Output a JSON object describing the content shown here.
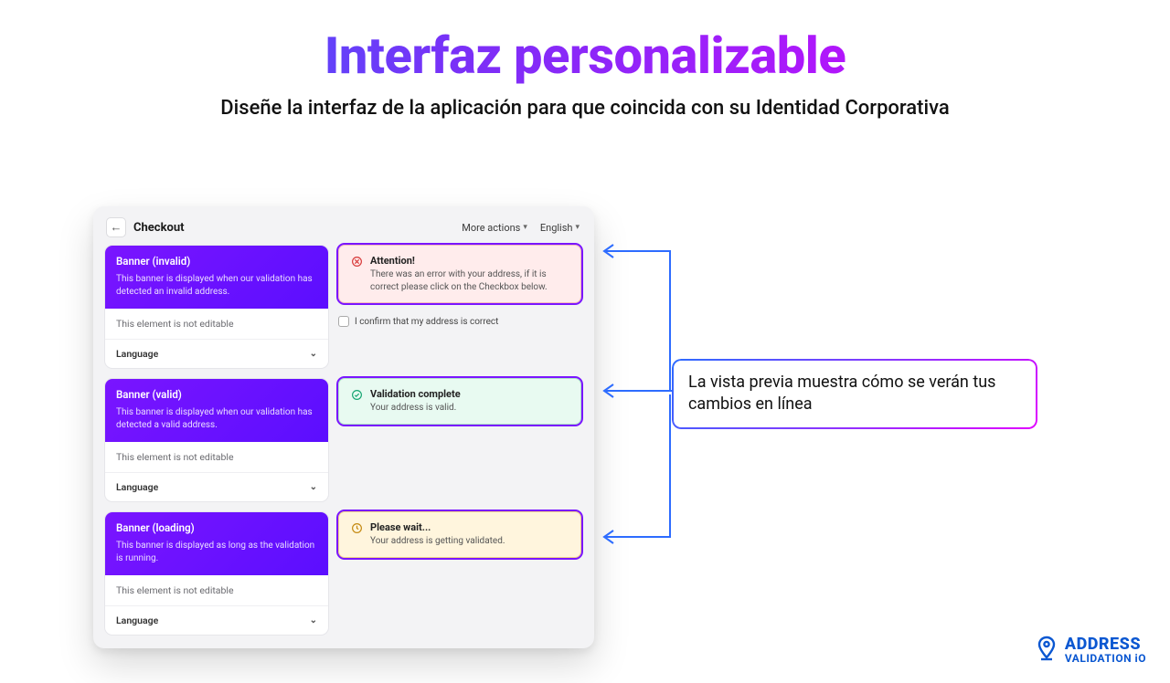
{
  "page": {
    "title": "Interfaz personalizable",
    "subtitle": "Diseñe la interfaz de la aplicación para que coincida con su Identidad Corporativa"
  },
  "header": {
    "back": "←",
    "title": "Checkout",
    "more_actions": "More actions",
    "language": "English"
  },
  "banners": {
    "invalid": {
      "title": "Banner (invalid)",
      "desc": "This banner is displayed when our validation has detected an invalid address.",
      "not_editable": "This element is not editable",
      "lang_label": "Language"
    },
    "valid": {
      "title": "Banner (valid)",
      "desc": "This banner is displayed when our validation has detected a valid address.",
      "not_editable": "This element is not editable",
      "lang_label": "Language"
    },
    "loading": {
      "title": "Banner (loading)",
      "desc": "This banner is displayed as long as the validation is running.",
      "not_editable": "This element is not editable",
      "lang_label": "Language"
    }
  },
  "previews": {
    "invalid": {
      "title": "Attention!",
      "desc": "There was an error with your address, if it is correct please click on the Checkbox below.",
      "confirm": "I confirm that my address is correct"
    },
    "valid": {
      "title": "Validation complete",
      "desc": "Your address is valid."
    },
    "loading": {
      "title": "Please wait...",
      "desc": "Your address is getting validated."
    }
  },
  "callout": {
    "text": "La vista previa muestra cómo se verán tus cambios en línea"
  },
  "brand": {
    "line1": "ADDRESS",
    "line2": "VALIDATION iO"
  }
}
